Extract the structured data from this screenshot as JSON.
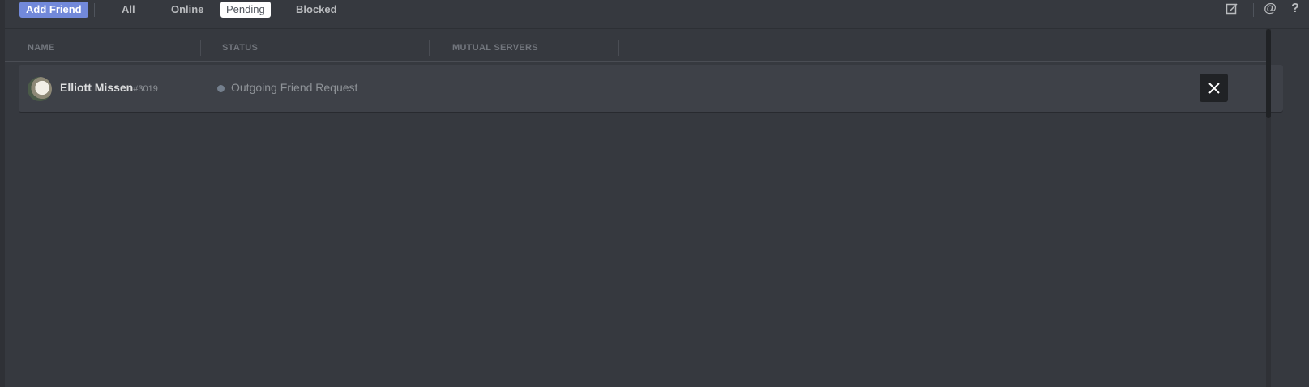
{
  "tabs": {
    "add_friend": "Add Friend",
    "all": "All",
    "online": "Online",
    "pending": "Pending",
    "blocked": "Blocked",
    "selected": "Pending"
  },
  "top_icons": {
    "compose": "new-dm-icon",
    "mention": "@",
    "help": "?"
  },
  "columns": {
    "name": "NAME",
    "status": "STATUS",
    "mutual_servers": "MUTUAL SERVERS"
  },
  "friends": [
    {
      "username": "Elliott Missen",
      "discriminator": "#3019",
      "status": "Outgoing Friend Request",
      "status_color": "#747f8d"
    }
  ],
  "colors": {
    "background": "#36393f",
    "accent": "#7289da",
    "row_background": "#3e4148"
  }
}
